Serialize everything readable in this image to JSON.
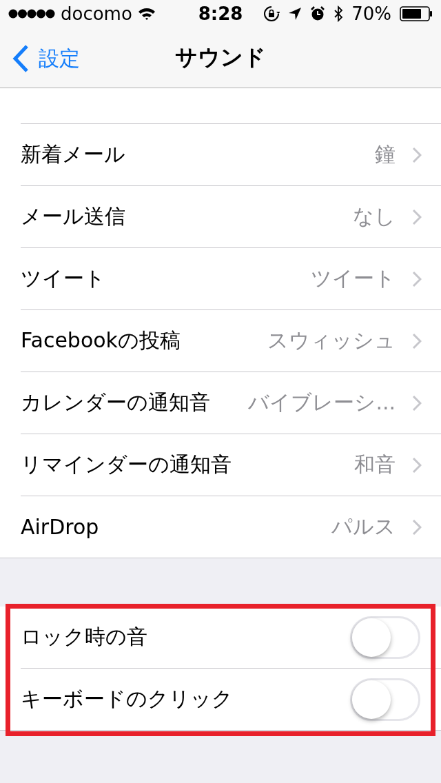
{
  "status_bar": {
    "carrier": "docomo",
    "time": "8:28",
    "battery": "70%"
  },
  "nav": {
    "back": "設定",
    "title": "サウンド"
  },
  "sound_rows": [
    {
      "label": "新着メール",
      "value": "鐘"
    },
    {
      "label": "メール送信",
      "value": "なし"
    },
    {
      "label": "ツイート",
      "value": "ツイート"
    },
    {
      "label": "Facebookの投稿",
      "value": "スウィッシュ"
    },
    {
      "label": "カレンダーの通知音",
      "value": "バイブレーシ..."
    },
    {
      "label": "リマインダーの通知音",
      "value": "和音"
    },
    {
      "label": "AirDrop",
      "value": "パルス"
    }
  ],
  "toggle_section": {
    "highlighted": true,
    "rows": [
      {
        "label": "ロック時の音",
        "on": false
      },
      {
        "label": "キーボードのクリック",
        "on": false
      }
    ]
  }
}
